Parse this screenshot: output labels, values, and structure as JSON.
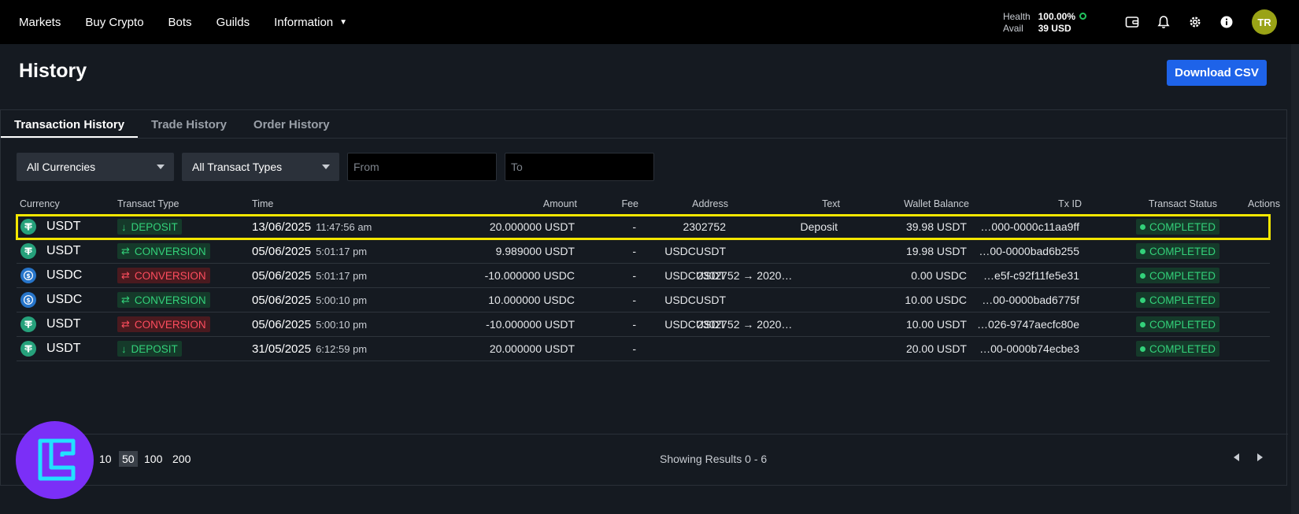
{
  "nav": {
    "links": [
      "Markets",
      "Buy Crypto",
      "Bots",
      "Guilds",
      "Information"
    ],
    "health_label": "Health",
    "health_value": "100.00%",
    "avail_label": "Avail",
    "avail_value": "39 USD",
    "avatar_initials": "TR"
  },
  "page": {
    "title": "History",
    "download_label": "Download CSV"
  },
  "tabs": [
    "Transaction History",
    "Trade History",
    "Order History"
  ],
  "filters": {
    "currency": "All Currencies",
    "type": "All Transact Types",
    "from_placeholder": "From",
    "to_placeholder": "To"
  },
  "table": {
    "headers": [
      "Currency",
      "Transact Type",
      "Time",
      "Amount",
      "Fee",
      "Address",
      "Text",
      "Wallet Balance",
      "Tx ID",
      "Transact Status",
      "Actions"
    ],
    "rows": [
      {
        "currency": "USDT",
        "coin": "usdt",
        "type": "DEPOSIT",
        "type_color": "green",
        "type_icon": "arrow-down",
        "date": "13/06/2025",
        "time": "11:47:56 am",
        "amount": "20.000000 USDT",
        "fee": "-",
        "address": "2302752",
        "text": "Deposit",
        "balance": "39.98 USDT",
        "txid": "…000-0000c11aa9ff",
        "status": "COMPLETED"
      },
      {
        "currency": "USDT",
        "coin": "usdt",
        "type": "CONVERSION",
        "type_color": "green",
        "type_icon": "swap",
        "date": "05/06/2025",
        "time": "5:01:17 pm",
        "amount": "9.989000 USDT",
        "fee": "-",
        "address": "USDCUSDT",
        "text": "",
        "balance": "19.98 USDT",
        "txid": "…00-0000bad6b255",
        "status": "COMPLETED"
      },
      {
        "currency": "USDC",
        "coin": "usdc",
        "type": "CONVERSION",
        "type_color": "red",
        "type_icon": "swap",
        "date": "05/06/2025",
        "time": "5:01:17 pm",
        "amount": "-10.000000 USDC",
        "fee": "-",
        "address": "USDCUSDT",
        "text": "2302752 → 2020…",
        "balance": "0.00 USDC",
        "txid": "…e5f-c92f11fe5e31",
        "status": "COMPLETED"
      },
      {
        "currency": "USDC",
        "coin": "usdc",
        "type": "CONVERSION",
        "type_color": "green",
        "type_icon": "swap",
        "date": "05/06/2025",
        "time": "5:00:10 pm",
        "amount": "10.000000 USDC",
        "fee": "-",
        "address": "USDCUSDT",
        "text": "",
        "balance": "10.00 USDC",
        "txid": "…00-0000bad6775f",
        "status": "COMPLETED"
      },
      {
        "currency": "USDT",
        "coin": "usdt",
        "type": "CONVERSION",
        "type_color": "red",
        "type_icon": "swap",
        "date": "05/06/2025",
        "time": "5:00:10 pm",
        "amount": "-10.000000 USDT",
        "fee": "-",
        "address": "USDCUSDT",
        "text": "2302752 → 2020…",
        "balance": "10.00 USDT",
        "txid": "…026-9747aecfc80e",
        "status": "COMPLETED"
      },
      {
        "currency": "USDT",
        "coin": "usdt",
        "type": "DEPOSIT",
        "type_color": "green",
        "type_icon": "arrow-down",
        "date": "31/05/2025",
        "time": "6:12:59 pm",
        "amount": "20.000000 USDT",
        "fee": "-",
        "address": "",
        "text": "",
        "balance": "20.00 USDT",
        "txid": "…00-0000b74ecbe3",
        "status": "COMPLETED"
      }
    ]
  },
  "pagination": {
    "page_sizes": [
      "10",
      "50",
      "100",
      "200"
    ],
    "active_size": "50",
    "showing": "Showing Results 0 - 6"
  },
  "colors": {
    "accent": "#1e63e9",
    "positive": "#33d17a",
    "negative": "#ff4d5e",
    "highlight": "#f3e600",
    "logo": "#7b2ff7"
  }
}
